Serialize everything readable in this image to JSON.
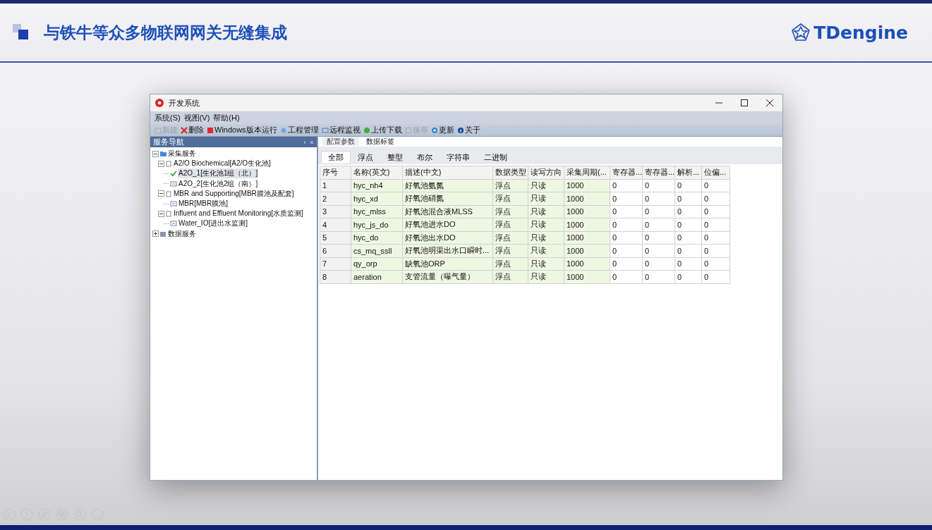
{
  "slide": {
    "title": "与铁牛等众多物联网网关无缝集成",
    "logo": "TDengine"
  },
  "window": {
    "title": "开发系统"
  },
  "menu": [
    "系统(S)",
    "视图(V)",
    "帮助(H)"
  ],
  "toolbar": [
    {
      "label": "新建",
      "kind": "new",
      "disabled": true
    },
    {
      "label": "删除",
      "kind": "delete",
      "disabled": false
    },
    {
      "label": "Windows版本运行",
      "kind": "run",
      "disabled": false
    },
    {
      "label": "工程管理",
      "kind": "project",
      "disabled": false
    },
    {
      "label": "远程监视",
      "kind": "monitor",
      "disabled": false
    },
    {
      "label": "上传下载",
      "kind": "upload",
      "disabled": false
    },
    {
      "label": "保存",
      "kind": "save",
      "disabled": true
    },
    {
      "label": "更新",
      "kind": "update",
      "disabled": false
    },
    {
      "label": "关于",
      "kind": "about",
      "disabled": false
    }
  ],
  "sidebar": {
    "title": "服务导航",
    "tree": [
      {
        "label": "采集服务",
        "kind": "folder",
        "expanded": true,
        "selected": false,
        "children": [
          {
            "label": "A2/O Biochemical[A2/O生化池]",
            "kind": "station",
            "expanded": true,
            "selected": false,
            "children": [
              {
                "label": "A2O_1[生化池1组（北）]",
                "kind": "device-ok",
                "selected": true
              },
              {
                "label": "A2O_2[生化池2组（南）]",
                "kind": "device",
                "selected": false
              }
            ]
          },
          {
            "label": "MBR and Supporting[MBR膜池及配套]",
            "kind": "station",
            "expanded": true,
            "selected": false,
            "children": [
              {
                "label": "MBR[MBR膜池]",
                "kind": "device",
                "selected": false
              }
            ]
          },
          {
            "label": "Influent and Effluent Monitoring[水质监测]",
            "kind": "station",
            "expanded": true,
            "selected": false,
            "children": [
              {
                "label": "Water_IO[进出水监测]",
                "kind": "device",
                "selected": false
              }
            ]
          }
        ]
      },
      {
        "label": "数据服务",
        "kind": "service",
        "expanded": false,
        "selected": false
      }
    ]
  },
  "subtabs": [
    {
      "label": "配置参数",
      "selected": false
    },
    {
      "label": "数据标签",
      "selected": true
    }
  ],
  "filters": [
    {
      "label": "全部",
      "selected": true
    },
    {
      "label": "浮点",
      "selected": false
    },
    {
      "label": "整型",
      "selected": false
    },
    {
      "label": "布尔",
      "selected": false
    },
    {
      "label": "字符串",
      "selected": false
    },
    {
      "label": "二进制",
      "selected": false
    }
  ],
  "table": {
    "columns": [
      "序号",
      "名称(英文)",
      "描述(中文)",
      "数据类型",
      "读写方向",
      "采集周期(...",
      "寄存器...",
      "寄存器...",
      "解析...",
      "位偏..."
    ],
    "rows": [
      [
        "1",
        "hyc_nh4",
        "好氧池氨氮",
        "浮点",
        "只读",
        "1000",
        "0",
        "0",
        "0",
        "0"
      ],
      [
        "2",
        "hyc_xd",
        "好氧池硝氮",
        "浮点",
        "只读",
        "1000",
        "0",
        "0",
        "0",
        "0"
      ],
      [
        "3",
        "hyc_mlss",
        "好氧池混合液MLSS",
        "浮点",
        "只读",
        "1000",
        "0",
        "0",
        "0",
        "0"
      ],
      [
        "4",
        "hyc_js_do",
        "好氧池进水DO",
        "浮点",
        "只读",
        "1000",
        "0",
        "0",
        "0",
        "0"
      ],
      [
        "5",
        "hyc_do",
        "好氧池出水DO",
        "浮点",
        "只读",
        "1000",
        "0",
        "0",
        "0",
        "0"
      ],
      [
        "6",
        "cs_mq_ssll",
        "好氧池明渠出水口瞬时...",
        "浮点",
        "只读",
        "1000",
        "0",
        "0",
        "0",
        "0"
      ],
      [
        "7",
        "qy_orp",
        "缺氧池ORP",
        "浮点",
        "只读",
        "1000",
        "0",
        "0",
        "0",
        "0"
      ],
      [
        "8",
        "aeration",
        "支管流量（曝气量）",
        "浮点",
        "只读",
        "1000",
        "0",
        "0",
        "0",
        "0"
      ]
    ]
  }
}
